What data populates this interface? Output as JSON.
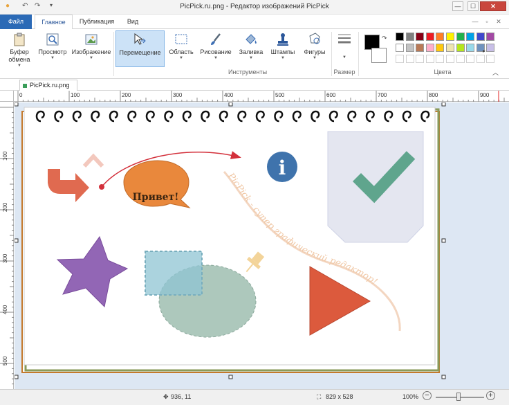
{
  "window": {
    "title": "PicPick.ru.png - Редактор изображений PicPick",
    "controls": {
      "minimize": "—",
      "maximize": "☐",
      "close": "✕"
    }
  },
  "ribbon_tabs": [
    "Файл",
    "Главное",
    "Публикация",
    "Вид"
  ],
  "ribbon_controls": {
    "restore": "▫",
    "close": "✕"
  },
  "ribbon": {
    "clipboard": "Буфер обмена",
    "view": "Просмотр",
    "image": "Изображение",
    "move": "Перемещение",
    "area": "Область",
    "draw": "Рисование",
    "fill": "Заливка",
    "stamps": "Штампы",
    "shapes": "Фигуры",
    "tools_group": "Инструменты",
    "size_group": "Размер",
    "colors_group": "Цвета",
    "primary_color": "#000000",
    "secondary_color": "#ffffff",
    "palette_row1": [
      "#000000",
      "#7f7f7f",
      "#880015",
      "#ed1c24",
      "#ff7f27",
      "#fff200",
      "#22b14c",
      "#00a2e8",
      "#3f48cc",
      "#a349a4"
    ],
    "palette_row2": [
      "#ffffff",
      "#c3c3c3",
      "#b97a57",
      "#ffaec9",
      "#ffc90e",
      "#efe4b0",
      "#b5e61d",
      "#99d9ea",
      "#7092be",
      "#c8bfe7"
    ]
  },
  "document_tab": "PicPick.ru.png",
  "ruler_top_labels": [
    "0",
    "100",
    "200",
    "300",
    "400",
    "500",
    "600",
    "700",
    "800",
    "900"
  ],
  "ruler_left_labels": [
    "100",
    "200",
    "300",
    "400",
    "500"
  ],
  "canvas": {
    "bubble_text": "Привет!",
    "curve_text": "PicPick - супер графический редактор!",
    "info_letter": "i"
  },
  "status": {
    "cursor_pos": "936, 11",
    "image_size": "829 x 528",
    "zoom": "100%",
    "zoom_out": "−",
    "zoom_in": "+"
  }
}
